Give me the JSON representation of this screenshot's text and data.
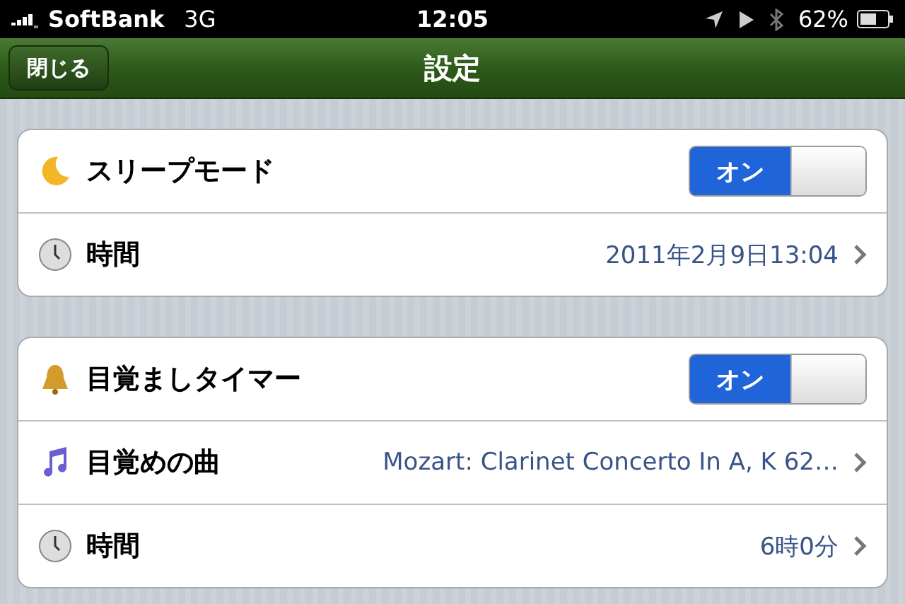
{
  "status_bar": {
    "carrier": "SoftBank",
    "network": "3G",
    "time": "12:05",
    "battery": "62%"
  },
  "nav_bar": {
    "back_button": "閉じる",
    "title": "設定"
  },
  "groups": [
    {
      "rows": [
        {
          "kind": "toggle",
          "label": "スリープモード",
          "switch_label": "オン",
          "on": true
        },
        {
          "kind": "value",
          "label": "時間",
          "value": "2011年2月9日13:04"
        }
      ]
    },
    {
      "rows": [
        {
          "kind": "toggle",
          "label": "目覚ましタイマー",
          "switch_label": "オン",
          "on": true
        },
        {
          "kind": "value",
          "label": "目覚めの曲",
          "value": "Mozart: Clarinet Concerto In A, K 62…"
        },
        {
          "kind": "value",
          "label": "時間",
          "value": "6時0分"
        }
      ]
    }
  ]
}
